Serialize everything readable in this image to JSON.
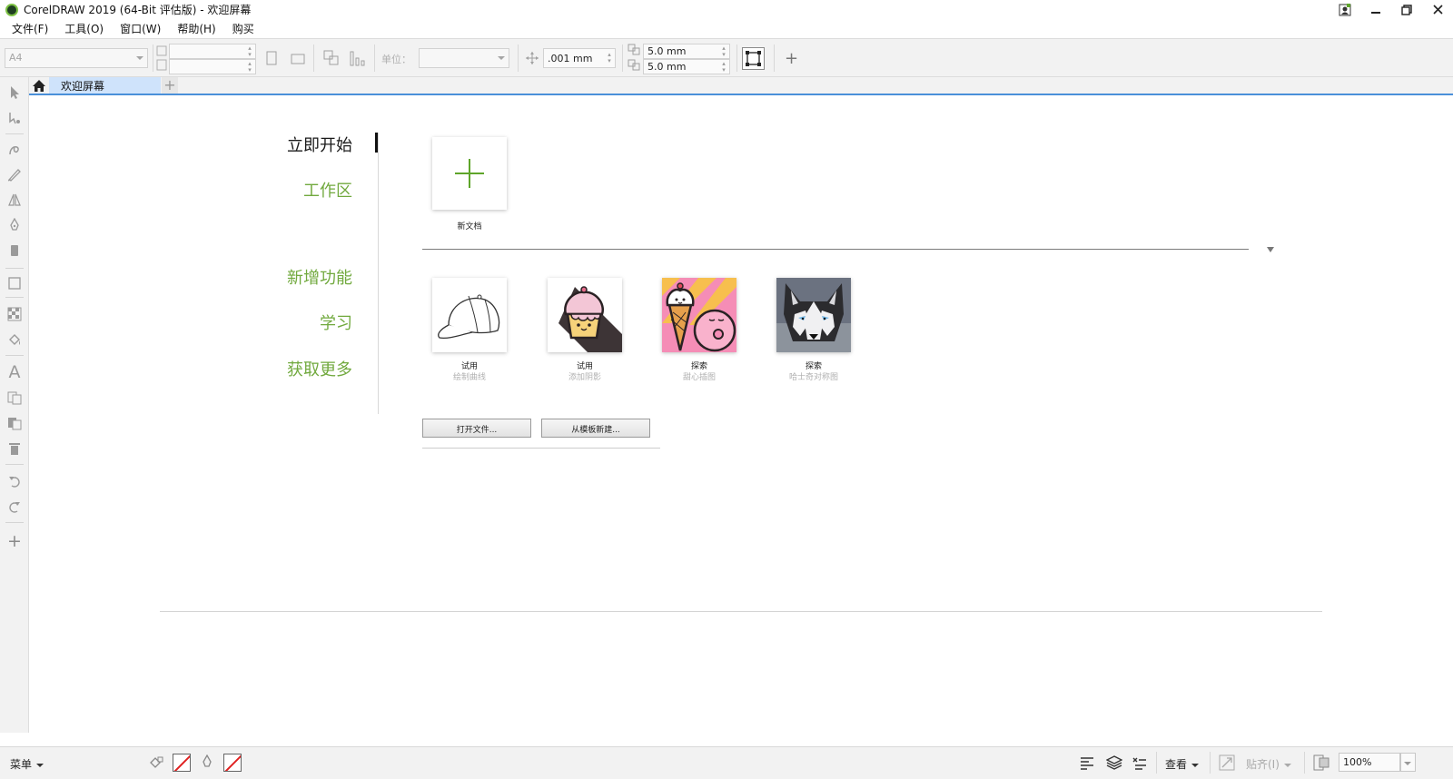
{
  "window": {
    "title": "CorelDRAW 2019 (64-Bit 评估版) - 欢迎屏幕",
    "controls": [
      "minimize",
      "restore",
      "close"
    ]
  },
  "menu": [
    "文件(F)",
    "工具(O)",
    "窗口(W)",
    "帮助(H)",
    "购买"
  ],
  "propbar": {
    "page_size": "A4",
    "units_label": "单位：",
    "nudge": ".001 mm",
    "dup_x": "5.0 mm",
    "dup_y": "5.0 mm"
  },
  "tabs": {
    "welcome": "欢迎屏幕"
  },
  "welcome": {
    "nav": [
      "立即开始",
      "工作区",
      "新增功能",
      "学习",
      "获取更多"
    ],
    "active_nav": "立即开始",
    "new_doc_label": "新文档",
    "items": [
      {
        "label": "试用",
        "sub": "绘制曲线",
        "icon": "baseball-cap"
      },
      {
        "label": "试用",
        "sub": "添加阴影",
        "icon": "cupcake"
      },
      {
        "label": "探索",
        "sub": "甜心插图",
        "icon": "ice-cream-donut"
      },
      {
        "label": "探索",
        "sub": "哈士奇对称图",
        "icon": "husky"
      }
    ],
    "buttons": {
      "open": "打开文件...",
      "template": "从模板新建..."
    }
  },
  "statusbar": {
    "menu_label": "菜单",
    "view_label": "查看",
    "snap_label": "贴齐(I)",
    "zoom": "100%"
  },
  "colors": {
    "accent_green": "#71a93e",
    "tab_blue": "#cfe3fb",
    "active_line": "#4a90d9"
  }
}
